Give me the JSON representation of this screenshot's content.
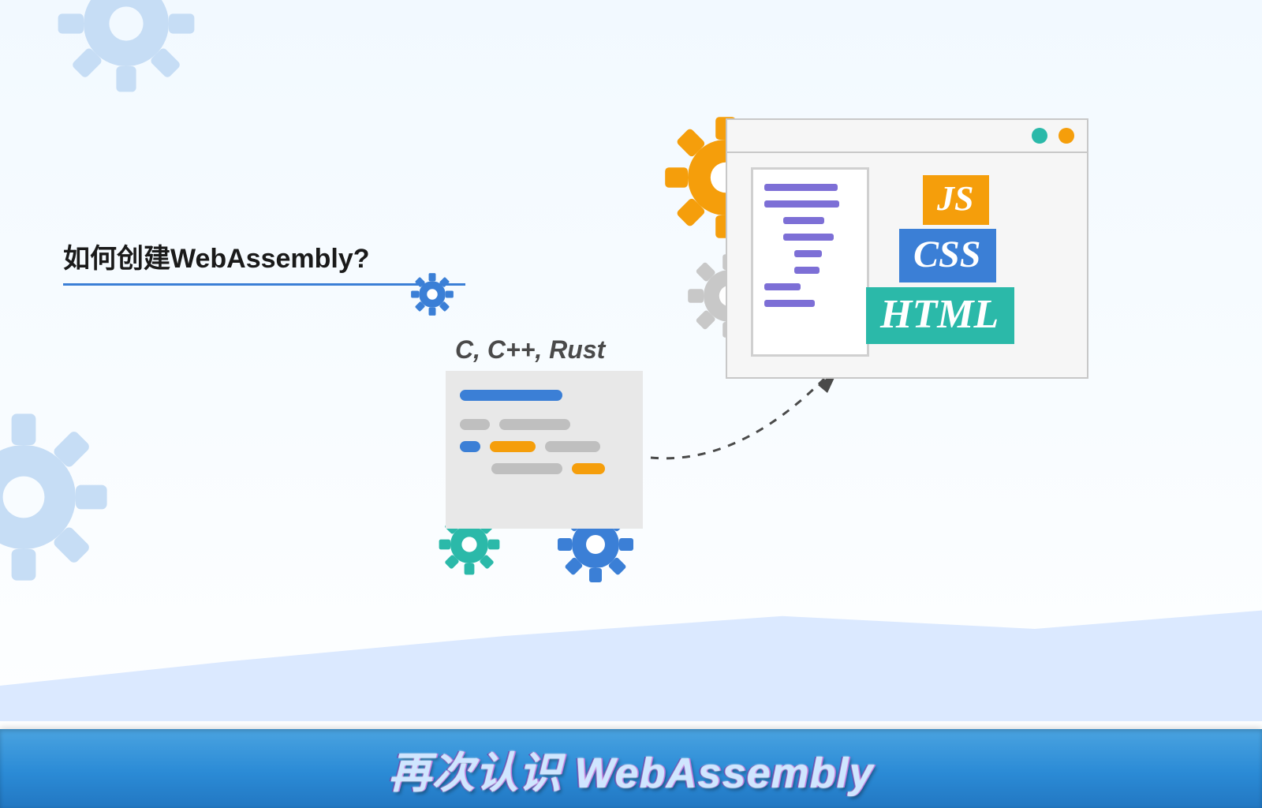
{
  "title": "如何创建WebAssembly?",
  "source_label": "C, C++, Rust",
  "tags": {
    "js": "JS",
    "css": "CSS",
    "html": "HTML"
  },
  "banner": "再次认识 WebAssembly",
  "colors": {
    "blue": "#3b7fd6",
    "orange": "#f59e0b",
    "teal": "#2bb9a9",
    "purple": "#7d6fd6",
    "panel_gray": "#e8e8e8",
    "light_blue_bg": "#dbe9ff"
  }
}
